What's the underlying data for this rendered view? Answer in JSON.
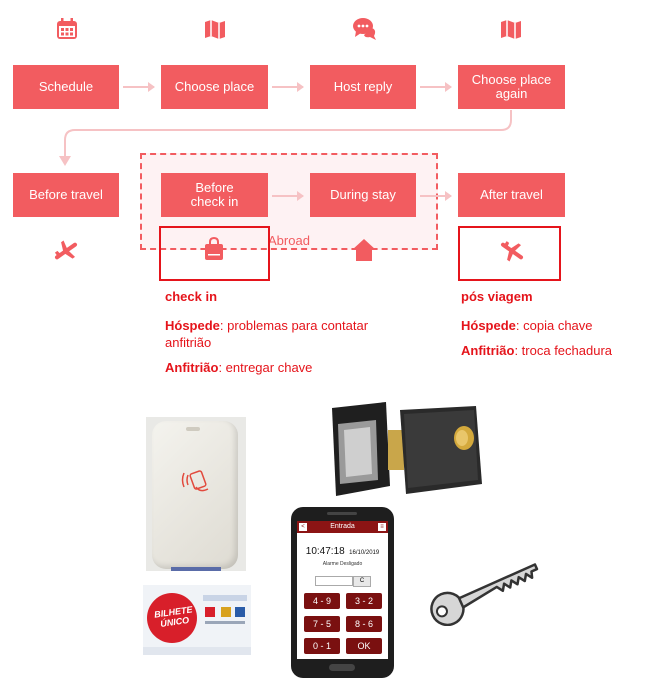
{
  "colors": {
    "accent": "#f25c60",
    "highlight": "#e5141b",
    "connector": "#f6c2c4"
  },
  "flow": {
    "row1": [
      "Schedule",
      "Choose place",
      "Host reply",
      "Choose place again"
    ],
    "row2": [
      "Before travel",
      "Before check in",
      "During stay",
      "After travel"
    ],
    "group_label": "Abroad",
    "icons_row1": [
      "calendar-icon",
      "map-icon",
      "chat-icon",
      "map-icon"
    ],
    "icons_row2": [
      "airplane-takeoff-icon",
      "shopping-bag-icon",
      "home-icon",
      "airplane-landing-icon"
    ]
  },
  "notes": {
    "checkin": {
      "title": "check in",
      "guest_label": "Hóspede",
      "guest_text": ": problemas para contatar anfitrião",
      "host_label": "Anfitrião",
      "host_text": ": entregar chave"
    },
    "after": {
      "title": "pós viagem",
      "guest_label": "Hóspede",
      "guest_text": ": copia chave",
      "host_label": "Anfitrião",
      "host_text": ": troca fechadura"
    }
  },
  "card": {
    "brand_line1": "BILHETE",
    "brand_line2": "ÚNICO"
  },
  "phone": {
    "header": "Entrada",
    "time": "10:47:18",
    "date": "16/10/2019",
    "status": "Alarme Desligado",
    "c_button": "C",
    "keys": [
      "4 - 9",
      "3 - 2",
      "7 - 5",
      "8 - 6",
      "0 - 1",
      "OK"
    ]
  }
}
